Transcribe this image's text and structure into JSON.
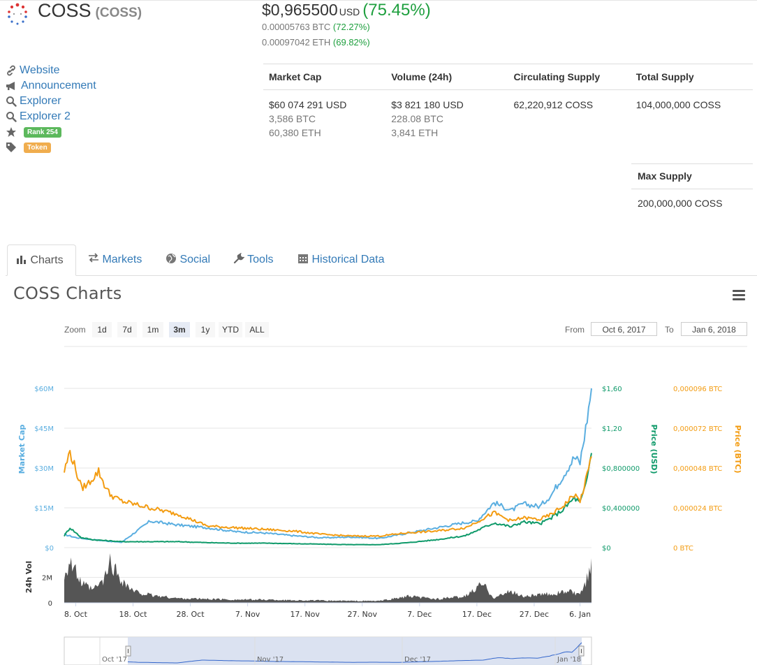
{
  "coin": {
    "name": "COSS",
    "symbol": "(COSS)"
  },
  "price": {
    "usd": "$0,965500",
    "usd_unit": "USD",
    "usd_change": "(75.45%)",
    "btc": "0.00005763 BTC",
    "btc_change": "(72.27%)",
    "eth": "0.00097042 ETH",
    "eth_change": "(69.82%)"
  },
  "links": [
    {
      "icon": "link-icon",
      "label": "Website"
    },
    {
      "icon": "bullhorn-icon",
      "label": "Announcement"
    },
    {
      "icon": "search-icon",
      "label": "Explorer"
    },
    {
      "icon": "search-icon",
      "label": "Explorer 2"
    }
  ],
  "badges": {
    "rank": {
      "label": "Rank 254",
      "color": "#5cb85c"
    },
    "type": {
      "label": "Token",
      "color": "#f0ad4e"
    }
  },
  "stats": {
    "headers": [
      "Market Cap",
      "Volume (24h)",
      "Circulating Supply",
      "Total Supply"
    ],
    "market_cap": [
      "$60 074 291 USD",
      "3,586 BTC",
      "60,380 ETH"
    ],
    "volume": [
      "$3 821 180 USD",
      "228.08 BTC",
      "3,841 ETH"
    ],
    "circulating": "62,220,912 COSS",
    "total": "104,000,000 COSS",
    "max_header": "Max Supply",
    "max": "200,000,000 COSS"
  },
  "tabs": [
    {
      "icon": "bar-chart-icon",
      "label": "Charts",
      "active": true
    },
    {
      "icon": "exchange-icon",
      "label": "Markets",
      "active": false
    },
    {
      "icon": "globe-icon",
      "label": "Social",
      "active": false
    },
    {
      "icon": "wrench-icon",
      "label": "Tools",
      "active": false
    },
    {
      "icon": "calendar-icon",
      "label": "Historical Data",
      "active": false
    }
  ],
  "charts_title": "COSS Charts",
  "zoom": {
    "label": "Zoom",
    "buttons": [
      "1d",
      "7d",
      "1m",
      "3m",
      "1y",
      "YTD",
      "ALL"
    ],
    "selected": "3m",
    "from_label": "From",
    "from": "Oct 6, 2017",
    "to_label": "To",
    "to": "Jan 6, 2018"
  },
  "colors": {
    "market_cap": "#5aaee0",
    "price_usd": "#0f9a6a",
    "price_btc": "#f39c12",
    "volume": "#555555",
    "link": "#337ab7",
    "positive": "#1e9f3e"
  },
  "chart_data": {
    "type": "line",
    "x_range": [
      "2017-10-06",
      "2018-01-06"
    ],
    "x_tick_labels": [
      "8. Oct",
      "18. Oct",
      "28. Oct",
      "7. Nov",
      "17. Nov",
      "27. Nov",
      "7. Dec",
      "17. Dec",
      "27. Dec",
      "6. Jan"
    ],
    "axes": {
      "market_cap": {
        "label": "Market Cap",
        "ticks": [
          "$0",
          "$15M",
          "$30M",
          "$45M",
          "$60M"
        ],
        "range": [
          0,
          60000000
        ]
      },
      "price_usd": {
        "label": "Price (USD)",
        "ticks": [
          "$0",
          "$0,400000",
          "$0,800000",
          "$1,20",
          "$1,60"
        ],
        "range": [
          0,
          1.6
        ]
      },
      "price_btc": {
        "label": "Price (BTC)",
        "ticks": [
          "0 BTC",
          "0,000024 BTC",
          "0,000048 BTC",
          "0,000072 BTC",
          "0,000096 BTC"
        ],
        "range": [
          0,
          9.6e-05
        ]
      },
      "volume": {
        "label": "24h Vol",
        "ticks": [
          "0",
          "2M"
        ],
        "range": [
          0,
          4000000
        ]
      }
    },
    "series": [
      {
        "name": "Market Cap",
        "axis": "market_cap",
        "day": [
          0,
          2,
          5,
          10,
          15,
          20,
          25,
          30,
          35,
          40,
          45,
          50,
          55,
          60,
          65,
          70,
          72,
          75,
          78,
          80,
          83,
          85,
          87,
          89,
          90,
          91,
          92
        ],
        "values": [
          5000000,
          3800000,
          3000000,
          2000000,
          10000000,
          8500000,
          7500000,
          6000000,
          5500000,
          4500000,
          3700000,
          4000000,
          3500000,
          5500000,
          7500000,
          9500000,
          10000000,
          17000000,
          14000000,
          16500000,
          15500000,
          20000000,
          27000000,
          34000000,
          32000000,
          45000000,
          60000000
        ]
      },
      {
        "name": "Price (USD)",
        "axis": "price_usd",
        "day": [
          0,
          1,
          3,
          5,
          10,
          15,
          20,
          25,
          30,
          35,
          40,
          45,
          50,
          55,
          60,
          65,
          70,
          75,
          78,
          80,
          83,
          85,
          87,
          89,
          90,
          91,
          92
        ],
        "values": [
          0.12,
          0.2,
          0.1,
          0.08,
          0.06,
          0.06,
          0.06,
          0.05,
          0.045,
          0.045,
          0.04,
          0.035,
          0.03,
          0.03,
          0.05,
          0.08,
          0.12,
          0.25,
          0.21,
          0.26,
          0.24,
          0.3,
          0.38,
          0.5,
          0.45,
          0.62,
          0.95
        ]
      },
      {
        "name": "Price (BTC)",
        "axis": "price_btc",
        "day": [
          0,
          1,
          2,
          3,
          4,
          6,
          7,
          8,
          10,
          15,
          20,
          25,
          30,
          35,
          40,
          45,
          50,
          55,
          60,
          65,
          70,
          75,
          78,
          80,
          83,
          85,
          87,
          89,
          90,
          91,
          92
        ],
        "values": [
          4.6e-05,
          5.8e-05,
          4.7e-05,
          3.6e-05,
          3.8e-05,
          4.6e-05,
          3.8e-05,
          3.2e-05,
          2.8e-05,
          2.4e-05,
          2e-05,
          1.3e-05,
          1.2e-05,
          1.1e-05,
          1e-05,
          8e-06,
          7e-06,
          7e-06,
          9e-06,
          1e-05,
          1.2e-05,
          2.1e-05,
          1.6e-05,
          1.8e-05,
          1.7e-05,
          2e-05,
          2.5e-05,
          3.2e-05,
          2.8e-05,
          4e-05,
          5.5e-05
        ]
      }
    ],
    "volume": {
      "day": [
        0,
        1,
        3,
        5,
        7,
        8,
        10,
        12,
        15,
        20,
        25,
        30,
        35,
        40,
        45,
        50,
        55,
        60,
        65,
        70,
        73,
        75,
        78,
        80,
        85,
        88,
        90,
        91,
        92
      ],
      "values": [
        2200000,
        3300000,
        1500000,
        1000000,
        1800000,
        3200000,
        1800000,
        900000,
        600000,
        350000,
        300000,
        250000,
        250000,
        200000,
        180000,
        150000,
        150000,
        500000,
        300000,
        500000,
        1500000,
        400000,
        900000,
        500000,
        700000,
        900000,
        600000,
        1500000,
        3500000
      ]
    },
    "navigator_labels": [
      "Oct '17",
      "Nov '17",
      "Dec '17",
      "Jan '18"
    ]
  }
}
